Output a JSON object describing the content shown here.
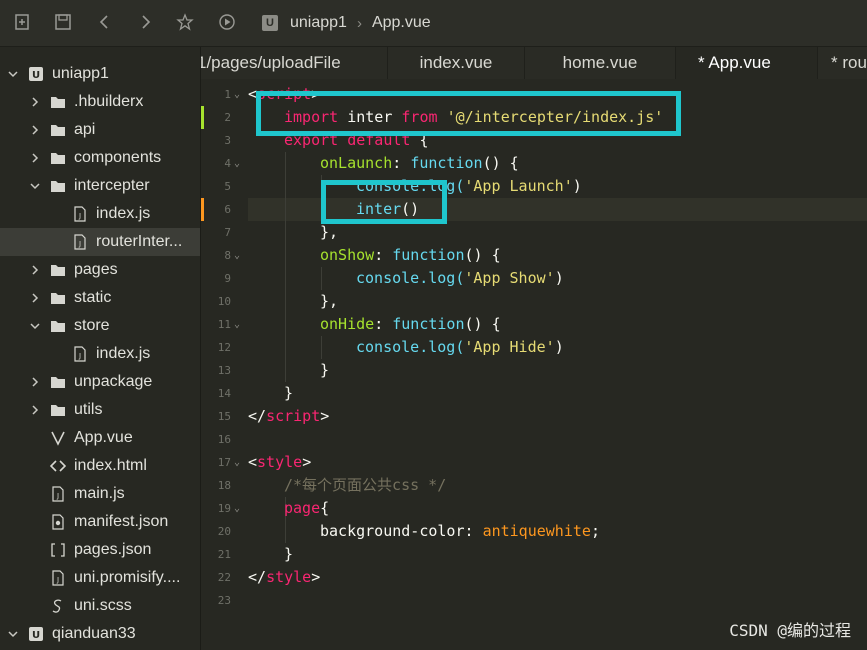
{
  "toolbar": {
    "buttons": [
      "new-file-icon",
      "save-icon",
      "back-icon",
      "forward-icon",
      "star-icon",
      "run-icon"
    ],
    "breadcrumb": {
      "badge": "U",
      "project": "uniapp1",
      "file": "App.vue"
    }
  },
  "sidebar": {
    "items": [
      {
        "label": "uniapp1",
        "type": "project",
        "expanded": true
      },
      {
        "label": ".hbuilderx",
        "type": "folder",
        "expanded": false
      },
      {
        "label": "api",
        "type": "folder",
        "expanded": false
      },
      {
        "label": "components",
        "type": "folder",
        "expanded": false
      },
      {
        "label": "intercepter",
        "type": "folder",
        "expanded": true
      },
      {
        "label": "index.js",
        "type": "js-file"
      },
      {
        "label": "routerInter...",
        "type": "js-file",
        "selected": true
      },
      {
        "label": "pages",
        "type": "folder",
        "expanded": false
      },
      {
        "label": "static",
        "type": "folder",
        "expanded": false
      },
      {
        "label": "store",
        "type": "folder",
        "expanded": true
      },
      {
        "label": "index.js",
        "type": "js-file"
      },
      {
        "label": "unpackage",
        "type": "folder",
        "expanded": false
      },
      {
        "label": "utils",
        "type": "folder",
        "expanded": false
      },
      {
        "label": "App.vue",
        "type": "vue-file"
      },
      {
        "label": "index.html",
        "type": "html-file"
      },
      {
        "label": "main.js",
        "type": "js-file"
      },
      {
        "label": "manifest.json",
        "type": "json-settings-file"
      },
      {
        "label": "pages.json",
        "type": "json-file"
      },
      {
        "label": "uni.promisify....",
        "type": "js-file"
      },
      {
        "label": "uni.scss",
        "type": "scss-file"
      },
      {
        "label": "qianduan33",
        "type": "project",
        "expanded": true
      }
    ]
  },
  "tabs": [
    {
      "label": "1/pages/uploadFile",
      "active": false
    },
    {
      "label": "index.vue",
      "active": false
    },
    {
      "label": "home.vue",
      "active": false
    },
    {
      "label": "* App.vue",
      "active": true
    },
    {
      "label": "* rou",
      "active": false
    }
  ],
  "editor": {
    "line_numbers": [
      "1",
      "2",
      "3",
      "4",
      "5",
      "6",
      "7",
      "8",
      "9",
      "10",
      "11",
      "12",
      "13",
      "14",
      "15",
      "16",
      "17",
      "18",
      "19",
      "20",
      "21",
      "22",
      "23"
    ],
    "lines": {
      "l1": {
        "open": "<",
        "tag": "script",
        "close": ">"
      },
      "l2": {
        "kw_import": "import",
        "name": "inter",
        "kw_from": "from",
        "path": "'@/intercepter/index.js'"
      },
      "l3": {
        "kw_export": "export",
        "kw_default": "default",
        "brace": "{"
      },
      "l4": {
        "key": "onLaunch",
        "colon": ":",
        "fn": "function",
        "rest": "() {"
      },
      "l5": {
        "obj": "console",
        "method": ".log(",
        "str": "'App Launch'",
        "end": ")"
      },
      "l6": {
        "call": "inter",
        "parens": "()"
      },
      "l7": {
        "text": "},"
      },
      "l8": {
        "key": "onShow",
        "colon": ":",
        "fn": "function",
        "rest": "() {"
      },
      "l9": {
        "obj": "console",
        "method": ".log(",
        "str": "'App Show'",
        "end": ")"
      },
      "l10": {
        "text": "},"
      },
      "l11": {
        "key": "onHide",
        "colon": ":",
        "fn": "function",
        "rest": "() {"
      },
      "l12": {
        "obj": "console",
        "method": ".log(",
        "str": "'App Hide'",
        "end": ")"
      },
      "l13": {
        "text": "}"
      },
      "l14": {
        "text": "}"
      },
      "l15": {
        "open": "</",
        "tag": "script",
        "close": ">"
      },
      "l17": {
        "open": "<",
        "tag": "style",
        "close": ">"
      },
      "l18": {
        "comment": "/*每个页面公共css */"
      },
      "l19": {
        "sel": "page",
        "brace": "{"
      },
      "l20": {
        "prop": "background-color",
        "colon": ": ",
        "val": "antiquewhite",
        "semi": ";"
      },
      "l21": {
        "text": "}"
      },
      "l22": {
        "open": "</",
        "tag": "style",
        "close": ">"
      }
    }
  },
  "watermark": "CSDN @编的过程",
  "colors": {
    "highlight_box": "#1fc6cd",
    "editor_bg": "#272822",
    "keyword": "#f92672",
    "string": "#e6db74",
    "function": "#a6e22e"
  }
}
